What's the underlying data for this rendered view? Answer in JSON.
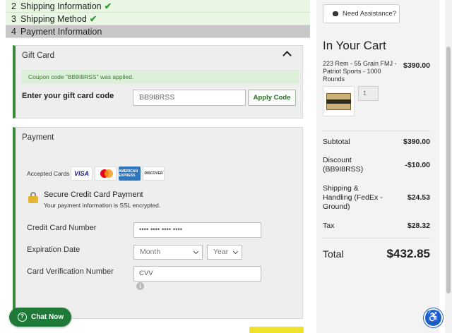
{
  "checkout_steps": [
    {
      "num": "2",
      "label": "Shipping Information",
      "status": "done"
    },
    {
      "num": "3",
      "label": "Shipping Method",
      "status": "done"
    },
    {
      "num": "4",
      "label": "Payment Information",
      "status": "active"
    }
  ],
  "gift_card": {
    "title": "Gift Card",
    "notice": "Coupon code \"BB9I8RSS\" was applied.",
    "label": "Enter your gift card code",
    "value": "BB9I8RSS",
    "apply_label": "Apply Code"
  },
  "payment": {
    "title": "Payment",
    "accepted_label": "Accepted Cards",
    "cards": [
      "VISA",
      "MasterCard",
      "AMERICAN EXPRESS",
      "DISCOVER"
    ],
    "secure_title": "Secure Credit Card Payment",
    "secure_sub": "Your payment information is SSL encrypted.",
    "cc_label": "Credit Card Number",
    "cc_placeholder": "•••• •••• •••• ••••",
    "exp_label": "Expiration Date",
    "month_placeholder": "Month",
    "year_placeholder": "Year",
    "cvv_label": "Card Verification Number",
    "cvv_placeholder": "CVV"
  },
  "chat": {
    "label": "Chat Now"
  },
  "cart": {
    "need_help": "Need Assistance?",
    "title": "In Your Cart",
    "product_name": "223 Rem - 55 Grain FMJ - Patriot Sports - 1000 Rounds",
    "product_price": "$390.00",
    "quantity": "1",
    "subtotal_label": "Subtotal",
    "subtotal": "$390.00",
    "discount_label": "Discount (BB9I8RSS)",
    "discount": "-$10.00",
    "shipping_label": "Shipping & Handling (FedEx - Ground)",
    "shipping": "$24.53",
    "tax_label": "Tax",
    "tax": "$28.32",
    "total_label": "Total",
    "total": "$432.85"
  },
  "colors": {
    "accent_green": "#3a8a3a",
    "button_yellow": "#f0e22a",
    "accessibility_blue": "#1a5fc6"
  }
}
